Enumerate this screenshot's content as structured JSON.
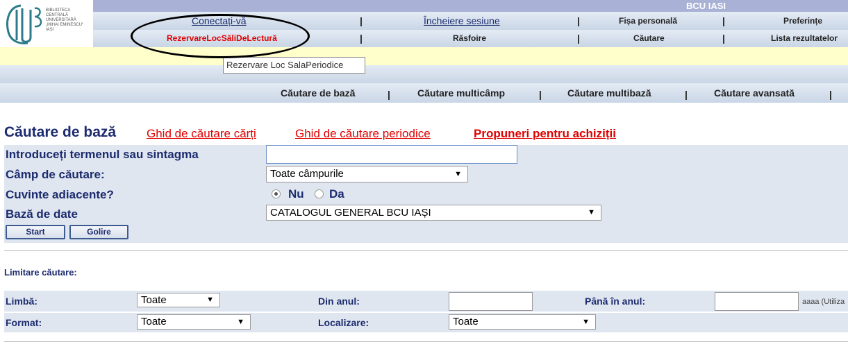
{
  "logo": {
    "lines": [
      "BIBLIOTECA",
      "CENTRALĂ",
      "UNIVERSITARĂ",
      "„MIHAI EMINESCU\"",
      "IAȘI"
    ]
  },
  "topbar": {
    "title": "BCU IASI"
  },
  "nav1": {
    "connect": "Conectați-vă",
    "logout": "Încheiere sesiune",
    "profile": "Fișa personală",
    "prefs": "Preferințe"
  },
  "nav2": {
    "reserve": "RezervareLocSăliDeLectură",
    "browse": "Răsfoire",
    "search": "Căutare",
    "results": "Lista rezultatelor"
  },
  "separator": "|",
  "tooltip": "Rezervare Loc SalaPeriodice",
  "tabs": {
    "basic": "Căutare de bază",
    "multifield": "Căutare multicâmp",
    "multibase": "Căutare multibază",
    "advanced": "Căutare avansată"
  },
  "heading": "Căutare de bază",
  "links": {
    "books_guide": "Ghid de căutare cărți",
    "periodicals_guide": "Ghid de căutare periodice",
    "proposals": "Propuneri pentru achiziții"
  },
  "form": {
    "term_label": "Introduceți termenul sau sintagma",
    "term_value": "",
    "field_label": "Câmp de căutare:",
    "field_value": "Toate câmpurile",
    "adjacent_label": "Cuvinte adiacente?",
    "adjacent_no": "Nu",
    "adjacent_yes": "Da",
    "db_label": "Bază de date",
    "db_value": "CATALOGUL GENERAL BCU IAȘI",
    "start": "Start",
    "clear": "Golire"
  },
  "limits": {
    "title": "Limitare căutare:",
    "language_label": "Limbă:",
    "language_value": "Toate",
    "from_year_label": "Din anul:",
    "to_year_label": "Până în anul:",
    "year_hint": "aaaa (Utiliza",
    "format_label": "Format:",
    "format_value": "Toate",
    "location_label": "Localizare:",
    "location_value": "Toate"
  },
  "icons": {
    "dropdown": "triangle-down-icon"
  },
  "colors": {
    "link_red": "#e00000",
    "label_navy": "#1c2b6e",
    "header_blue": "#a9b2d6",
    "highlight_yellow": "#ffffcc"
  }
}
